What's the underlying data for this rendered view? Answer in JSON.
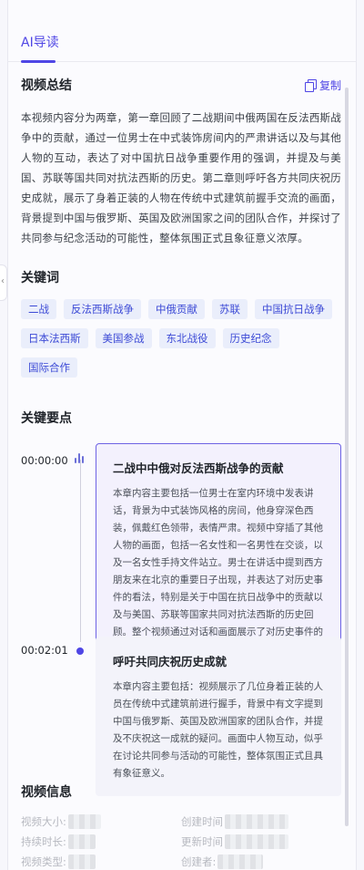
{
  "tab": {
    "label": "AI导读"
  },
  "summary": {
    "title": "视频总结",
    "copy_label": "复制",
    "text": "本视频内容分为两章，第一章回顾了二战期间中俄两国在反法西斯战争中的贡献，通过一位男士在中式装饰房间内的严肃讲话以及与其他人物的互动，表达了对中国抗日战争重要作用的强调，并提及与美国、苏联等国共同对抗法西斯的历史。第二章则呼吁各方共同庆祝历史成就，展示了身着正装的人物在传统中式建筑前握手交流的画面，背景提到中国与俄罗斯、英国及欧洲国家之间的团队合作，并探讨了共同参与纪念活动的可能性，整体氛围正式且象征意义浓厚。"
  },
  "keywords": {
    "title": "关键词",
    "items": [
      "二战",
      "反法西斯战争",
      "中俄贡献",
      "苏联",
      "中国抗日战争",
      "日本法西斯",
      "美国参战",
      "东北战役",
      "历史纪念",
      "国际合作"
    ]
  },
  "keypoints": {
    "title": "关键要点",
    "items": [
      {
        "time": "00:00:00",
        "title": "二战中中俄对反法西斯战争的贡献",
        "text": "本章内容主要包括一位男士在室内环境中发表讲话，背景为中式装饰风格的房间，他身穿深色西装，佩戴红色领带，表情严肃。视频中穿插了其他人物的画面，包括一名女性和一名男性在交谈，以及一名女性手持文件站立。男士在讲话中提到西方朋友来在北京的重要日子出现，并表达了对历史事件的看法，特别是关于中国在抗日战争中的贡献以及与美国、苏联等国家共同对抗法西斯的历史回顾。整个视频通过对话和画面展示了对历史事件的讨论和反思。"
      },
      {
        "time": "00:02:01",
        "title": "呼吁共同庆祝历史成就",
        "text": "本章内容主要包括：视频展示了几位身着正装的人员在传统中式建筑前进行握手，背景中有文字提到中国与俄罗斯、英国及欧洲国家的团队合作，并提及不庆祝这一成就的疑问。画面中人物互动，似乎在讨论共同参与活动的可能性，整体氛围正式且具有象征意义。"
      }
    ]
  },
  "info": {
    "title": "视频信息",
    "fields": {
      "size": "视频大小:",
      "created": "创建时间",
      "duration": "持续时长:",
      "updated": "更新时间",
      "type": "视频类型:",
      "creator": "创建者:"
    }
  },
  "colors": {
    "accent": "#4f46e5",
    "tag_bg": "#eaeefb",
    "card_active_border": "#6e63e4"
  }
}
